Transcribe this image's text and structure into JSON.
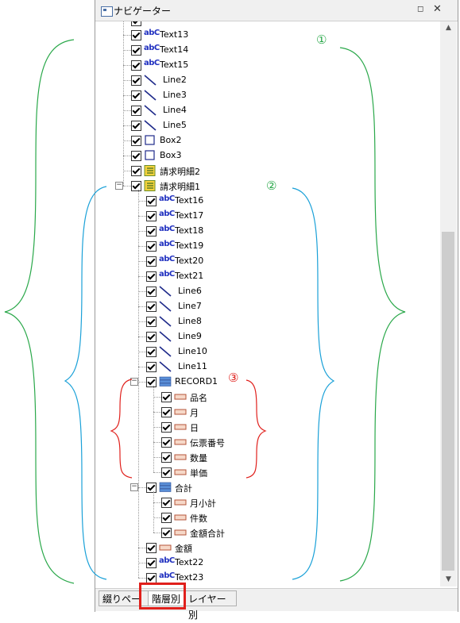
{
  "window": {
    "title": "ナビゲーター",
    "pin_glyph": "◻",
    "close_glyph": "✕"
  },
  "colors": {
    "green": "#2aa84a",
    "blue": "#1ba1d8",
    "red": "#e0201c",
    "check": "#000000"
  },
  "icons": {
    "text": "text-field-icon",
    "line": "line-icon",
    "box": "box-icon",
    "detail": "detail-band-icon",
    "record": "record-icon",
    "field": "field-icon"
  },
  "tree_rows": [
    {
      "label": "Text13",
      "type": "text"
    },
    {
      "label": "Text14",
      "type": "text"
    },
    {
      "label": "Text15",
      "type": "text"
    },
    {
      "label": "Line2",
      "type": "line"
    },
    {
      "label": "Line3",
      "type": "line"
    },
    {
      "label": "Line4",
      "type": "line"
    },
    {
      "label": "Line5",
      "type": "line"
    },
    {
      "label": "Box2",
      "type": "box"
    },
    {
      "label": "Box3",
      "type": "box"
    },
    {
      "label": "請求明細2",
      "type": "detail"
    },
    {
      "label": "請求明細1",
      "type": "detail"
    },
    {
      "label": "Text16",
      "type": "text"
    },
    {
      "label": "Text17",
      "type": "text"
    },
    {
      "label": "Text18",
      "type": "text"
    },
    {
      "label": "Text19",
      "type": "text"
    },
    {
      "label": "Text20",
      "type": "text"
    },
    {
      "label": "Text21",
      "type": "text"
    },
    {
      "label": "Line6",
      "type": "line"
    },
    {
      "label": "Line7",
      "type": "line"
    },
    {
      "label": "Line8",
      "type": "line"
    },
    {
      "label": "Line9",
      "type": "line"
    },
    {
      "label": "Line10",
      "type": "line"
    },
    {
      "label": "Line11",
      "type": "line"
    },
    {
      "label": "RECORD1",
      "type": "record"
    },
    {
      "label": "品名",
      "type": "field"
    },
    {
      "label": "月",
      "type": "field"
    },
    {
      "label": "日",
      "type": "field"
    },
    {
      "label": "伝票番号",
      "type": "field"
    },
    {
      "label": "数量",
      "type": "field"
    },
    {
      "label": "単価",
      "type": "field"
    },
    {
      "label": "合計",
      "type": "record"
    },
    {
      "label": "月小計",
      "type": "field"
    },
    {
      "label": "件数",
      "type": "field"
    },
    {
      "label": "金額合計",
      "type": "field"
    },
    {
      "label": "金額",
      "type": "field"
    },
    {
      "label": "Text22",
      "type": "text"
    },
    {
      "label": "Text23",
      "type": "text"
    }
  ],
  "tabs": [
    {
      "label": "綴りページ"
    },
    {
      "label": "階層別"
    },
    {
      "label": "レイヤー別"
    }
  ],
  "annotations": {
    "a1": "①",
    "a2": "②",
    "a3": "③"
  },
  "abc_text": "abC"
}
